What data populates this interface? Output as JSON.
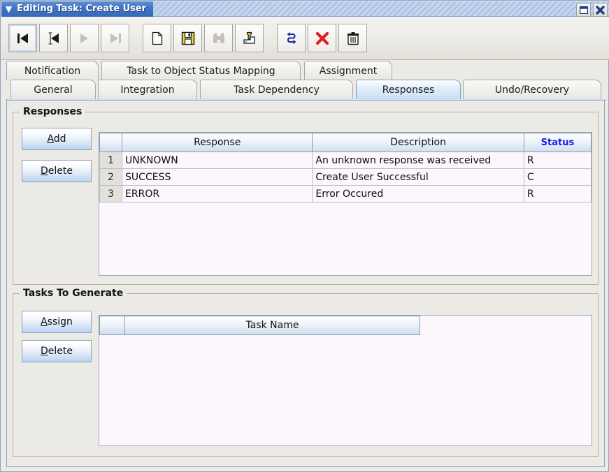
{
  "window": {
    "title": "Editing Task: Create User",
    "menu_icon": "chevron-down-icon",
    "controls": [
      {
        "name": "restore-button",
        "icon": "restore-icon"
      },
      {
        "name": "close-button",
        "icon": "close-icon"
      }
    ]
  },
  "toolbar": {
    "buttons": [
      {
        "name": "first-record-button",
        "icon": "first-record-icon",
        "enabled": true,
        "focused": true
      },
      {
        "name": "previous-record-button",
        "icon": "previous-record-icon",
        "enabled": true,
        "focused": false
      },
      {
        "name": "next-record-button",
        "icon": "next-record-icon",
        "enabled": false,
        "focused": false
      },
      {
        "name": "last-record-button",
        "icon": "last-record-icon",
        "enabled": false,
        "focused": false
      },
      {
        "name": "new-button",
        "icon": "new-document-icon",
        "enabled": true,
        "focused": false
      },
      {
        "name": "save-button",
        "icon": "floppy-disk-icon",
        "enabled": true,
        "focused": false
      },
      {
        "name": "find-button",
        "icon": "binoculars-icon",
        "enabled": false,
        "focused": false
      },
      {
        "name": "query-button",
        "icon": "query-funnel-icon",
        "enabled": true,
        "focused": false
      },
      {
        "name": "refresh-button",
        "icon": "refresh-arrows-icon",
        "enabled": true,
        "focused": false
      },
      {
        "name": "cancel-button",
        "icon": "red-x-icon",
        "enabled": true,
        "focused": false
      },
      {
        "name": "delete-button",
        "icon": "trash-can-icon",
        "enabled": true,
        "focused": false
      }
    ]
  },
  "tabs": {
    "row1": [
      {
        "label": "Notification",
        "selected": false
      },
      {
        "label": "Task to Object Status Mapping",
        "selected": false
      },
      {
        "label": "Assignment",
        "selected": false
      }
    ],
    "row2": [
      {
        "label": "General",
        "selected": false
      },
      {
        "label": "Integration",
        "selected": false
      },
      {
        "label": "Task Dependency",
        "selected": false
      },
      {
        "label": "Responses",
        "selected": true
      },
      {
        "label": "Undo/Recovery",
        "selected": false
      }
    ]
  },
  "responses": {
    "group_title": "Responses",
    "add_label": "Add",
    "add_mnemonic": "A",
    "add_rest": "dd",
    "delete_label": "Delete",
    "delete_mnemonic": "D",
    "delete_rest": "elete",
    "columns": [
      "",
      "Response",
      "Description",
      "Status"
    ],
    "rows": [
      {
        "num": "1",
        "response": "UNKNOWN",
        "description": "An unknown response was received",
        "status": "R"
      },
      {
        "num": "2",
        "response": "SUCCESS",
        "description": "Create User Successful",
        "status": "C"
      },
      {
        "num": "3",
        "response": "ERROR",
        "description": "Error Occured",
        "status": "R"
      }
    ]
  },
  "tasks_to_generate": {
    "group_title": "Tasks To Generate",
    "assign_label": "Assign",
    "assign_mnemonic": "A",
    "assign_rest": "ssign",
    "delete_label": "Delete",
    "delete_mnemonic": "D",
    "delete_rest": "elete",
    "columns": [
      "",
      "Task Name"
    ],
    "rows": []
  },
  "colors": {
    "title_blue": "#3f74c4",
    "tab_selected": "#c9e0f6",
    "status_header": "#1a1af0",
    "panel_bg": "#eceae5",
    "table_bg": "#fdf6fd",
    "accent_red": "#e02020",
    "accent_yellow": "#e8d54a"
  }
}
